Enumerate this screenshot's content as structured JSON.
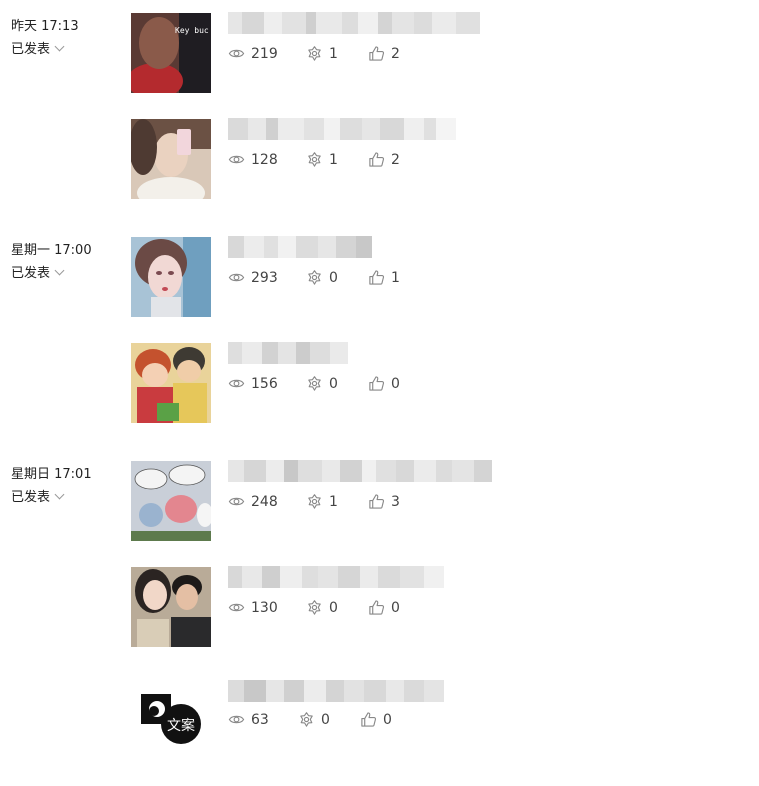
{
  "groups": [
    {
      "date": "昨天 17:13",
      "status": "已发表"
    },
    {
      "date": "星期一 17:00",
      "status": "已发表"
    },
    {
      "date": "星期日 17:01",
      "status": "已发表"
    }
  ],
  "articles": [
    {
      "views": "219",
      "shares": "1",
      "likes": "2"
    },
    {
      "views": "128",
      "shares": "1",
      "likes": "2"
    },
    {
      "views": "293",
      "shares": "0",
      "likes": "1"
    },
    {
      "views": "156",
      "shares": "0",
      "likes": "0"
    },
    {
      "views": "248",
      "shares": "1",
      "likes": "3"
    },
    {
      "views": "130",
      "shares": "0",
      "likes": "0"
    },
    {
      "views": "63",
      "shares": "0",
      "likes": "0"
    }
  ],
  "thumb_texts": {
    "a1": "Key buc",
    "a7": "文案"
  },
  "icons": {
    "views": "eye-icon",
    "shares": "share-icon",
    "likes": "thumbs-up-icon"
  }
}
